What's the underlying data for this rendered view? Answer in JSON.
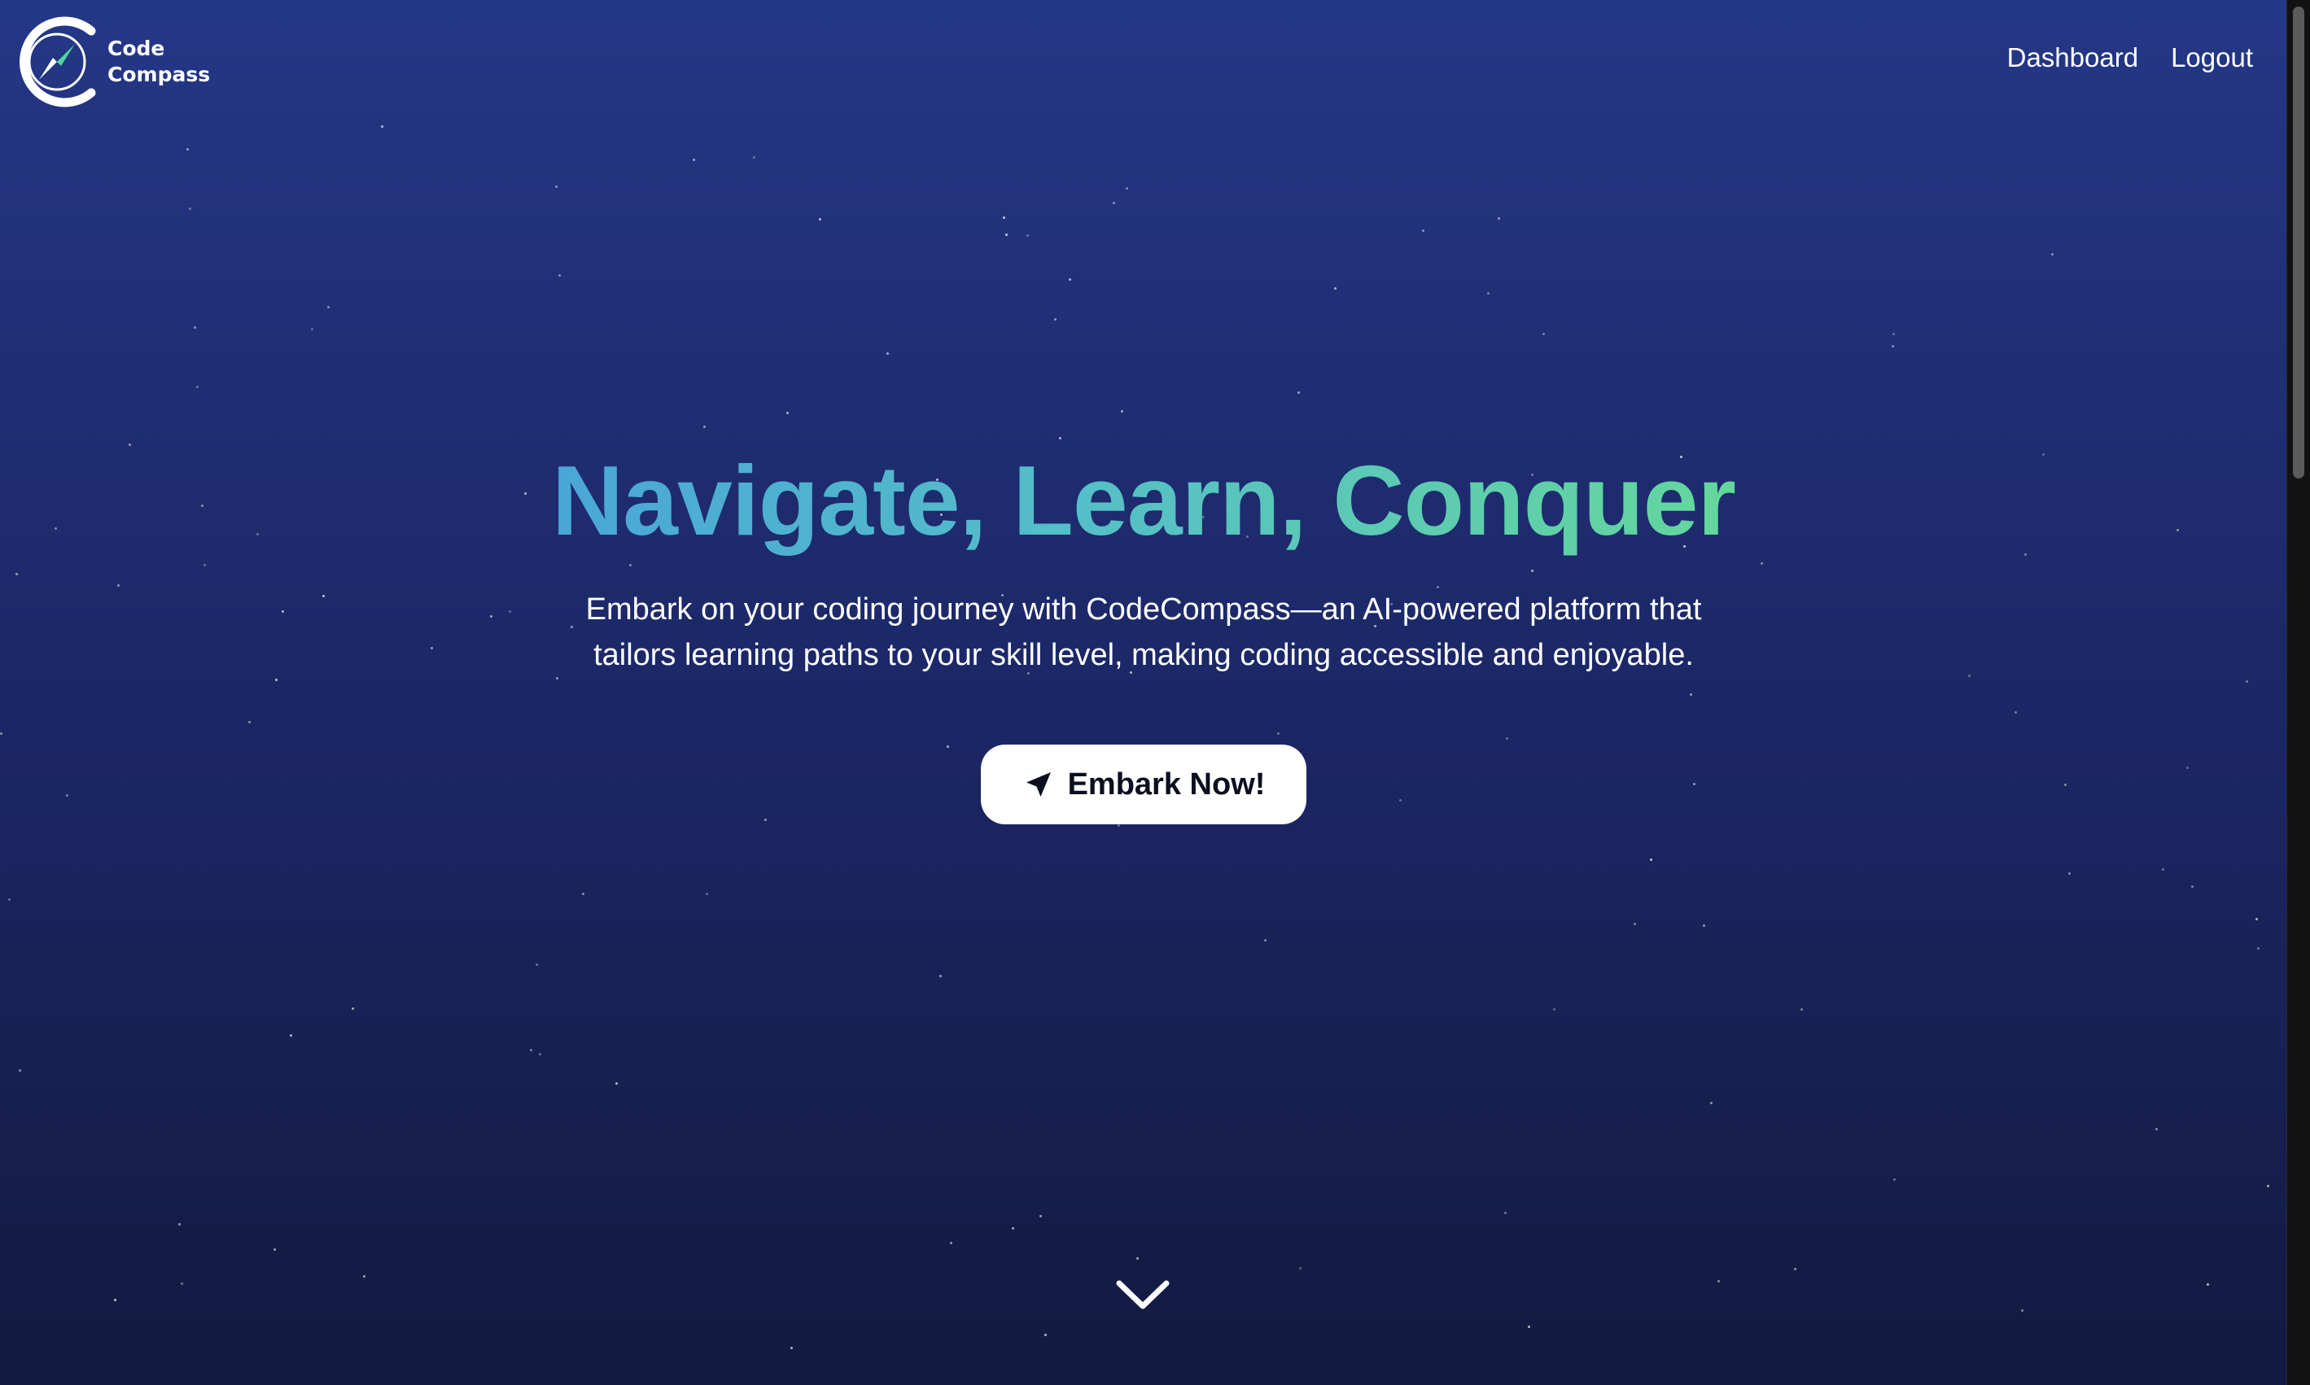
{
  "brand": {
    "name_line1": "Code",
    "name_line2": "Compass",
    "logo_icon": "compass-c-logo-icon"
  },
  "nav": {
    "dashboard": "Dashboard",
    "logout": "Logout"
  },
  "hero": {
    "headline": "Navigate, Learn, Conquer",
    "subtitle": "Embark on your coding journey with CodeCompass—an AI-powered platform that tailors learning paths to your skill level, making coding accessible and enjoyable.",
    "cta_label": "Embark Now!",
    "cta_icon": "navigation-arrow-icon"
  },
  "scroll_indicator": {
    "icon": "chevron-down-icon"
  },
  "colors": {
    "background_top": "#243787",
    "background_bottom": "#121a3f",
    "headline_gradient_start": "#4aa6d6",
    "headline_gradient_end": "#64d79c",
    "accent_green": "#4fd69c",
    "text": "#ffffff",
    "button_bg": "#ffffff",
    "button_text": "#0c0f1e"
  }
}
